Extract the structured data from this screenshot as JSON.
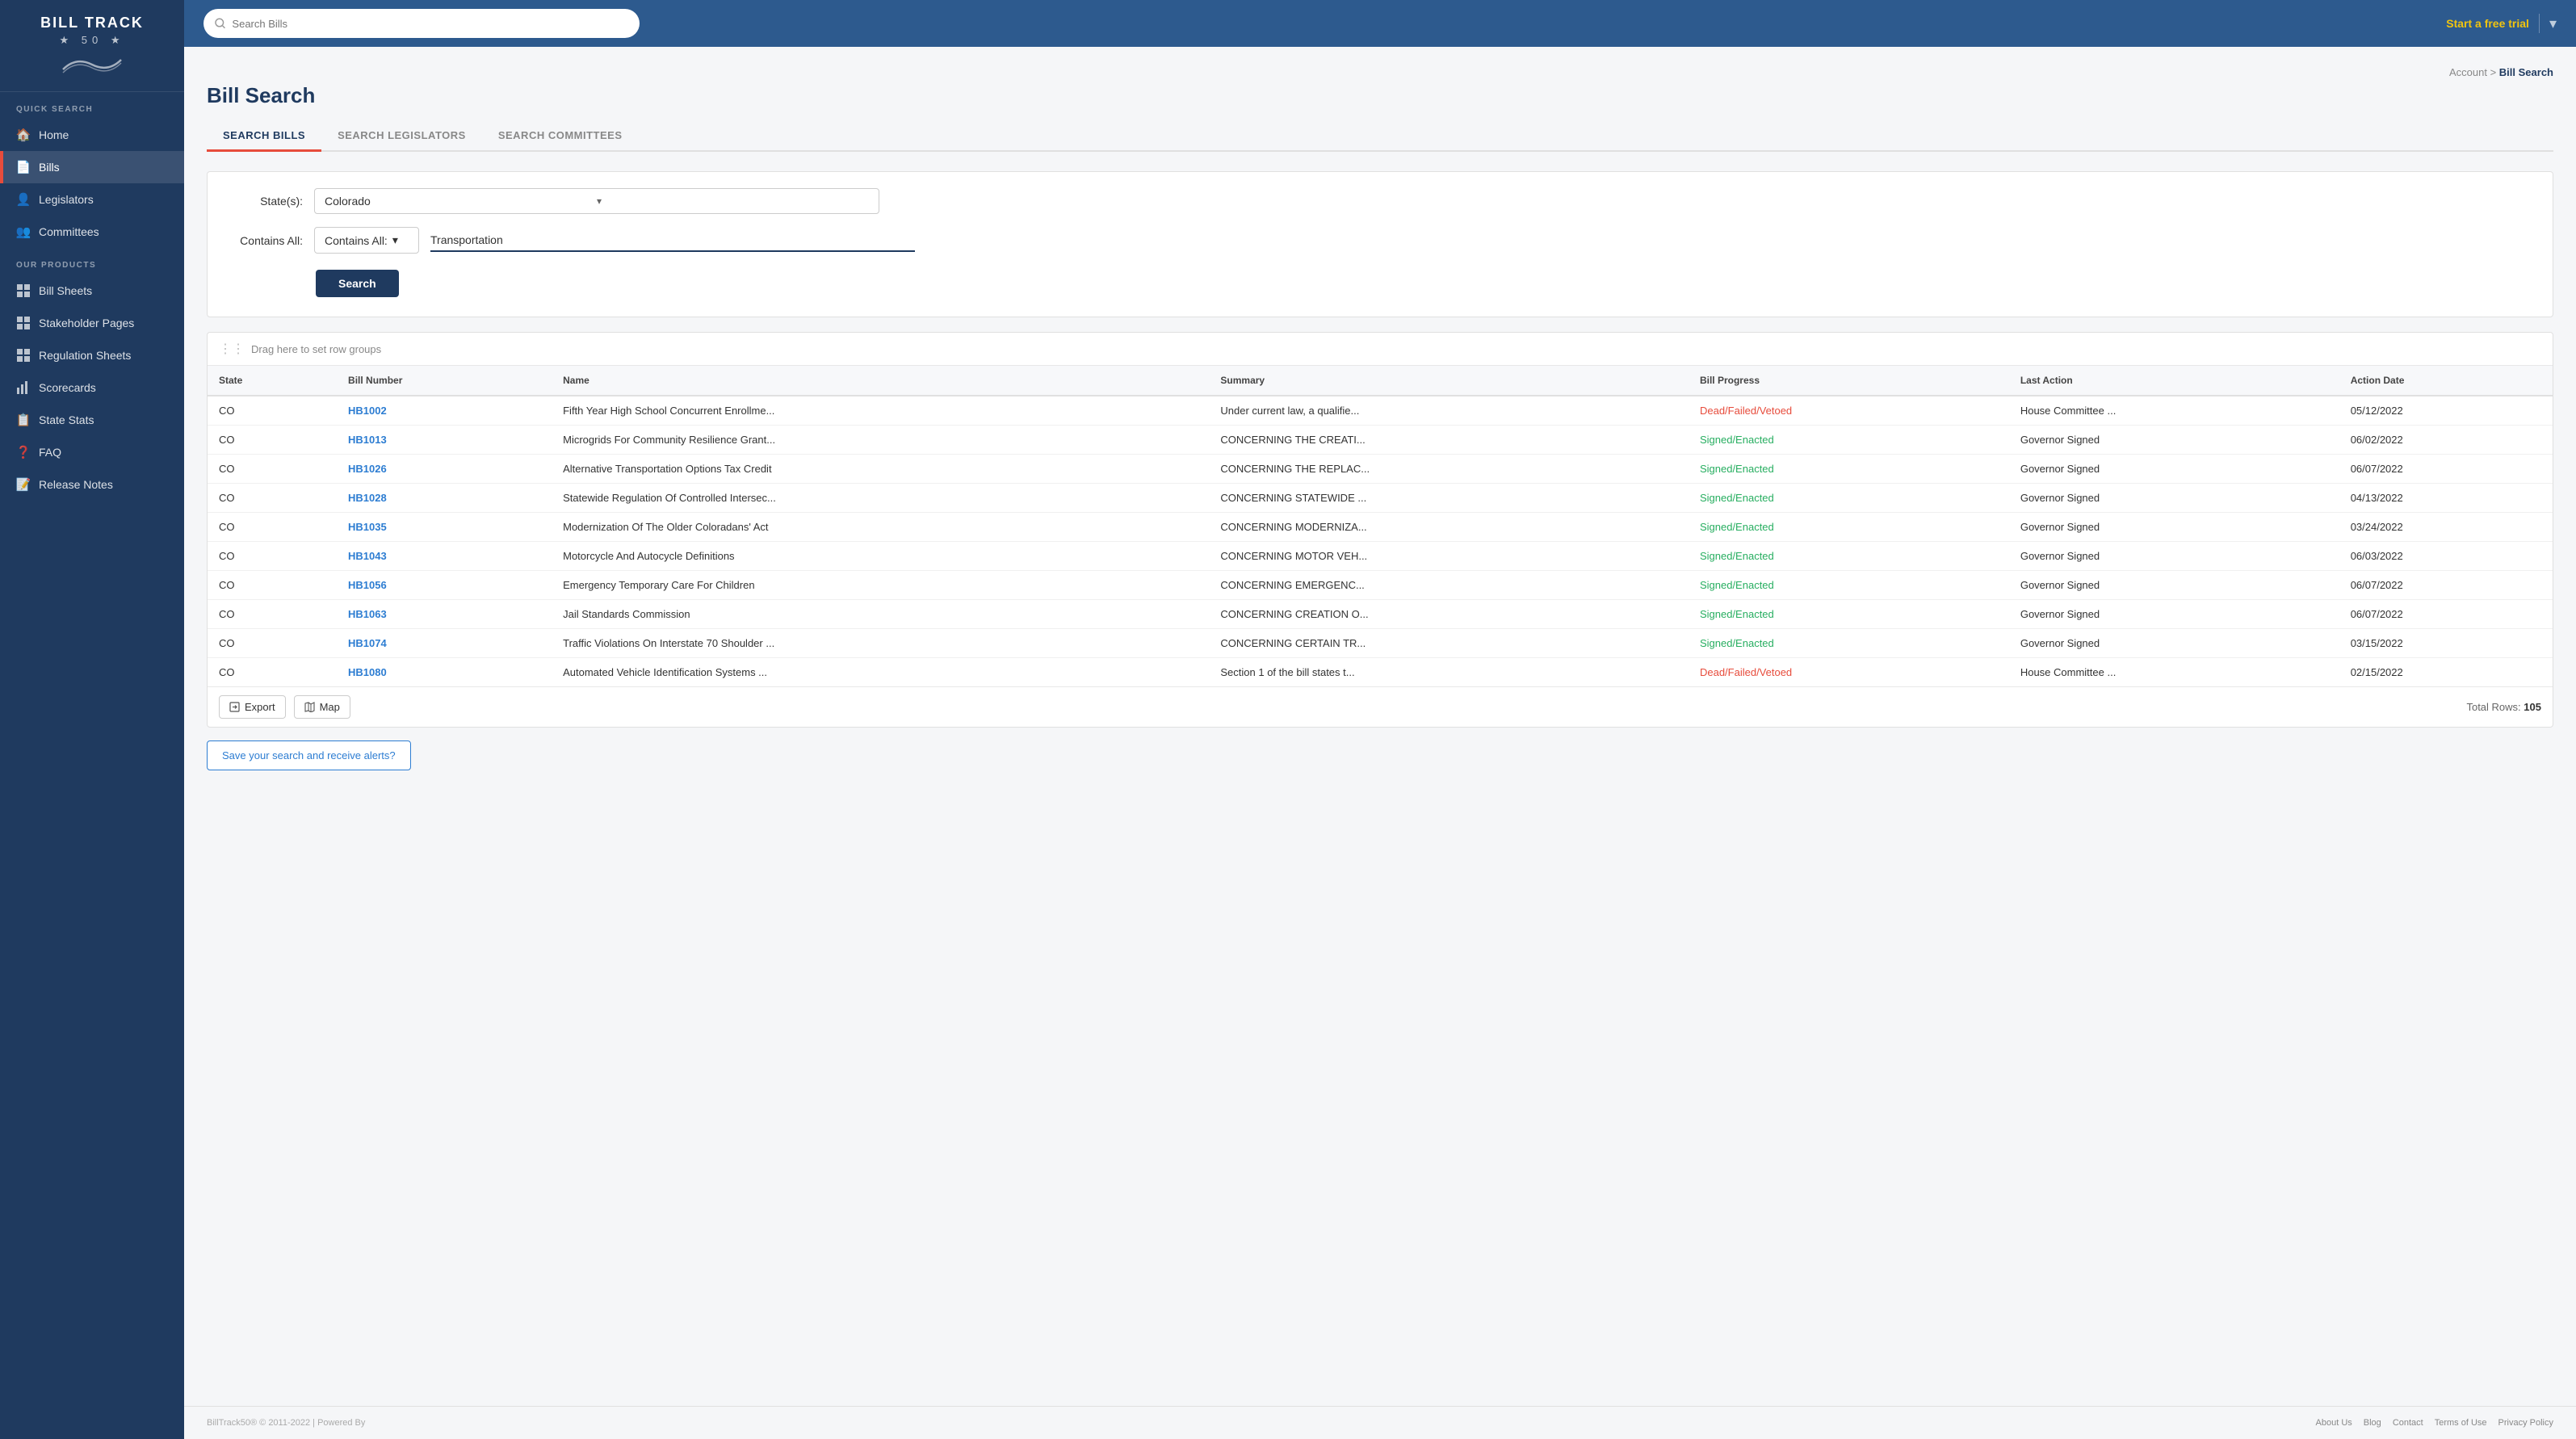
{
  "app": {
    "name": "BILL TRACK",
    "name_sub": "50",
    "logo_stars": "★ 50 ★"
  },
  "topbar": {
    "search_placeholder": "Search Bills",
    "free_trial": "Start a free trial"
  },
  "sidebar": {
    "quick_search_label": "QUICK SEARCH",
    "our_products_label": "OUR PRODUCTS",
    "nav_items": [
      {
        "id": "home",
        "label": "Home",
        "icon": "🏠"
      },
      {
        "id": "bills",
        "label": "Bills",
        "icon": "📄",
        "active": true
      },
      {
        "id": "legislators",
        "label": "Legislators",
        "icon": "👤"
      },
      {
        "id": "committees",
        "label": "Committees",
        "icon": "👥"
      }
    ],
    "product_items": [
      {
        "id": "bill-sheets",
        "label": "Bill Sheets",
        "icon": "▦"
      },
      {
        "id": "stakeholder-pages",
        "label": "Stakeholder Pages",
        "icon": "▦"
      },
      {
        "id": "regulation-sheets",
        "label": "Regulation Sheets",
        "icon": "▦"
      },
      {
        "id": "scorecards",
        "label": "Scorecards",
        "icon": "📊"
      },
      {
        "id": "state-stats",
        "label": "State Stats",
        "icon": "📋"
      },
      {
        "id": "faq",
        "label": "FAQ",
        "icon": "❓"
      },
      {
        "id": "release-notes",
        "label": "Release Notes",
        "icon": "📝"
      }
    ]
  },
  "page": {
    "title": "Bill Search",
    "breadcrumb_account": "Account",
    "breadcrumb_current": "Bill Search"
  },
  "tabs": [
    {
      "id": "search-bills",
      "label": "SEARCH BILLS",
      "active": true
    },
    {
      "id": "search-legislators",
      "label": "SEARCH LEGISLATORS",
      "active": false
    },
    {
      "id": "search-committees",
      "label": "SEARCH COMMITTEES",
      "active": false
    }
  ],
  "form": {
    "state_label": "State(s):",
    "state_value": "Colorado",
    "contains_label": "Contains All:",
    "contains_dropdown_label": "Contains All:",
    "contains_value": "Transportation",
    "search_button": "Search"
  },
  "table": {
    "drag_hint": "Drag here to set row groups",
    "columns": [
      "State",
      "Bill Number",
      "Name",
      "Summary",
      "Bill Progress",
      "Last Action",
      "Action Date"
    ],
    "rows": [
      {
        "state": "CO",
        "bill_number": "HB1002",
        "name": "Fifth Year High School Concurrent Enrollme...",
        "summary": "Under current law, a qualifie...",
        "progress": "Dead/Failed/Vetoed",
        "last_action": "House Committee ...",
        "action_date": "05/12/2022",
        "progress_class": "status-dead"
      },
      {
        "state": "CO",
        "bill_number": "HB1013",
        "name": "Microgrids For Community Resilience Grant...",
        "summary": "CONCERNING THE CREATI...",
        "progress": "Signed/Enacted",
        "last_action": "Governor Signed",
        "action_date": "06/02/2022",
        "progress_class": "status-signed"
      },
      {
        "state": "CO",
        "bill_number": "HB1026",
        "name": "Alternative Transportation Options Tax Credit",
        "summary": "CONCERNING THE REPLAC...",
        "progress": "Signed/Enacted",
        "last_action": "Governor Signed",
        "action_date": "06/07/2022",
        "progress_class": "status-signed"
      },
      {
        "state": "CO",
        "bill_number": "HB1028",
        "name": "Statewide Regulation Of Controlled Intersec...",
        "summary": "CONCERNING STATEWIDE ...",
        "progress": "Signed/Enacted",
        "last_action": "Governor Signed",
        "action_date": "04/13/2022",
        "progress_class": "status-signed"
      },
      {
        "state": "CO",
        "bill_number": "HB1035",
        "name": "Modernization Of The Older Coloradans' Act",
        "summary": "CONCERNING MODERNIZA...",
        "progress": "Signed/Enacted",
        "last_action": "Governor Signed",
        "action_date": "03/24/2022",
        "progress_class": "status-signed"
      },
      {
        "state": "CO",
        "bill_number": "HB1043",
        "name": "Motorcycle And Autocycle Definitions",
        "summary": "CONCERNING MOTOR VEH...",
        "progress": "Signed/Enacted",
        "last_action": "Governor Signed",
        "action_date": "06/03/2022",
        "progress_class": "status-signed"
      },
      {
        "state": "CO",
        "bill_number": "HB1056",
        "name": "Emergency Temporary Care For Children",
        "summary": "CONCERNING EMERGENC...",
        "progress": "Signed/Enacted",
        "last_action": "Governor Signed",
        "action_date": "06/07/2022",
        "progress_class": "status-signed"
      },
      {
        "state": "CO",
        "bill_number": "HB1063",
        "name": "Jail Standards Commission",
        "summary": "CONCERNING CREATION O...",
        "progress": "Signed/Enacted",
        "last_action": "Governor Signed",
        "action_date": "06/07/2022",
        "progress_class": "status-signed"
      },
      {
        "state": "CO",
        "bill_number": "HB1074",
        "name": "Traffic Violations On Interstate 70 Shoulder ...",
        "summary": "CONCERNING CERTAIN TR...",
        "progress": "Signed/Enacted",
        "last_action": "Governor Signed",
        "action_date": "03/15/2022",
        "progress_class": "status-signed"
      },
      {
        "state": "CO",
        "bill_number": "HB1080",
        "name": "Automated Vehicle Identification Systems ...",
        "summary": "Section 1 of the bill states t...",
        "progress": "Dead/Failed/Vetoed",
        "last_action": "House Committee ...",
        "action_date": "02/15/2022",
        "progress_class": "status-dead"
      }
    ],
    "export_button": "Export",
    "map_button": "Map",
    "total_rows_label": "Total Rows:",
    "total_rows_value": "105"
  },
  "save_alert": {
    "button": "Save your search and receive alerts?"
  },
  "footer": {
    "copyright": "BillTrack50® © 2011-2022  |  Powered By",
    "links": [
      "About Us",
      "Blog",
      "Contact",
      "Terms of Use",
      "Privacy Policy"
    ]
  }
}
